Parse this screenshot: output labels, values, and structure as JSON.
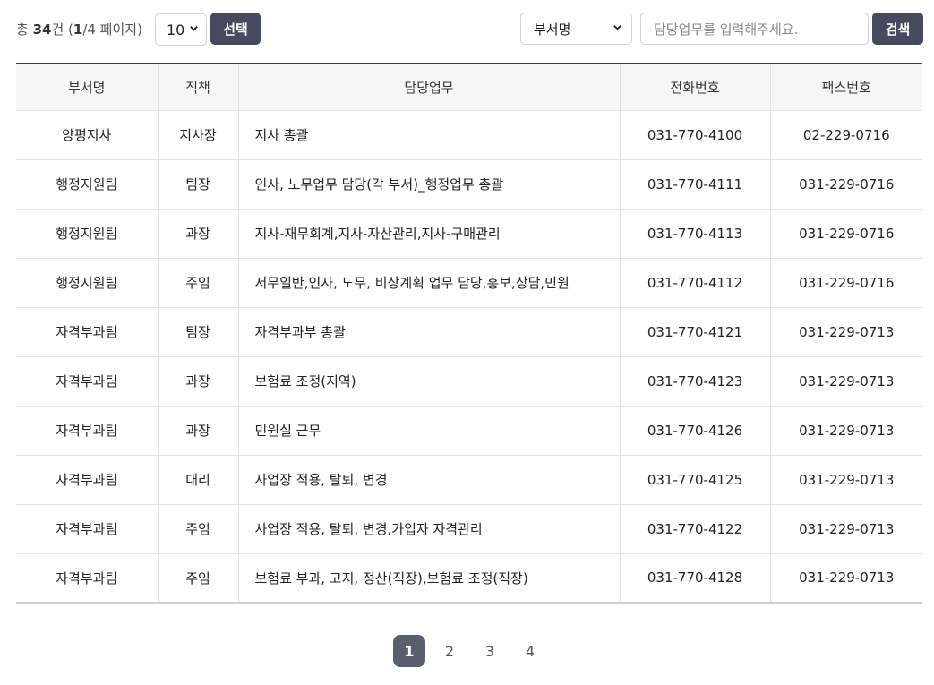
{
  "summary": {
    "prefix": "총 ",
    "total": "34",
    "unit": "건 (",
    "current_page": "1",
    "page_suffix": "/4 페이지)"
  },
  "page_size": {
    "value": "10"
  },
  "select_button": "선택",
  "search": {
    "field_value": "부서명",
    "placeholder": "담당업무를 입력해주세요.",
    "button_label": "검색"
  },
  "table": {
    "headers": [
      "부서명",
      "직책",
      "담당업무",
      "전화번호",
      "팩스번호"
    ],
    "rows": [
      [
        "양평지사",
        "지사장",
        "지사 총괄",
        "031-770-4100",
        "02-229-0716"
      ],
      [
        "행정지원팀",
        "팀장",
        "인사, 노무업무 담당(각 부서)_행정업무 총괄",
        "031-770-4111",
        "031-229-0716"
      ],
      [
        "행정지원팀",
        "과장",
        "지사-재무회계,지사-자산관리,지사-구매관리",
        "031-770-4113",
        "031-229-0716"
      ],
      [
        "행정지원팀",
        "주임",
        "서무일반,인사, 노무, 비상계획 업무 담당,홍보,상담,민원",
        "031-770-4112",
        "031-229-0716"
      ],
      [
        "자격부과팀",
        "팀장",
        "자격부과부 총괄",
        "031-770-4121",
        "031-229-0713"
      ],
      [
        "자격부과팀",
        "과장",
        "보험료 조정(지역)",
        "031-770-4123",
        "031-229-0713"
      ],
      [
        "자격부과팀",
        "과장",
        "민원실 근무",
        "031-770-4126",
        "031-229-0713"
      ],
      [
        "자격부과팀",
        "대리",
        "사업장 적용, 탈퇴, 변경",
        "031-770-4125",
        "031-229-0713"
      ],
      [
        "자격부과팀",
        "주임",
        "사업장 적용, 탈퇴, 변경,가입자 자격관리",
        "031-770-4122",
        "031-229-0713"
      ],
      [
        "자격부과팀",
        "주임",
        "보험료 부과, 고지, 정산(직장),보험료 조정(직장)",
        "031-770-4128",
        "031-229-0713"
      ]
    ]
  },
  "pagination": {
    "pages": [
      "1",
      "2",
      "3",
      "4"
    ],
    "active": "1"
  },
  "icons": {
    "dropdown": "chevron-down-icon"
  },
  "colors": {
    "dark_button": "#454a5e",
    "active_page": "#5a5f6e",
    "header_bg": "#f6f6f6"
  }
}
